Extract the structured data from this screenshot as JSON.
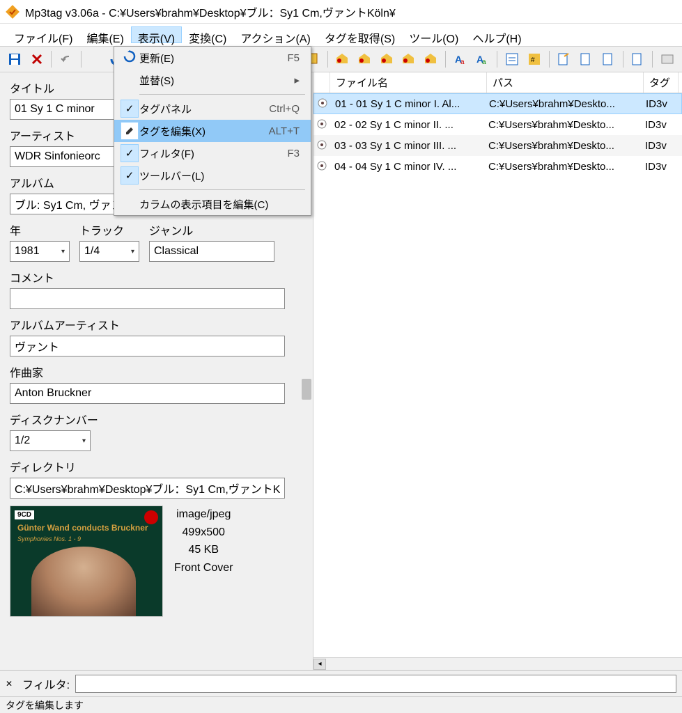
{
  "titlebar": {
    "text": "Mp3tag v3.06a  -  C:¥Users¥brahm¥Desktop¥ブル：Sy1 Cm,ヴァントKöln¥"
  },
  "menubar": {
    "items": [
      "ファイル(F)",
      "編集(E)",
      "表示(V)",
      "変換(C)",
      "アクション(A)",
      "タグを取得(S)",
      "ツール(O)",
      "ヘルプ(H)"
    ]
  },
  "dropdown": {
    "items": [
      {
        "label": "更新(E)",
        "shortcut": "F5",
        "icon": "refresh"
      },
      {
        "label": "並替(S)",
        "arrow": true
      },
      {
        "sep": true
      },
      {
        "label": "タグパネル",
        "shortcut": "Ctrl+Q",
        "checked": true
      },
      {
        "label": "タグを編集(X)",
        "shortcut": "ALT+T",
        "highlighted": true,
        "icon": "edit"
      },
      {
        "label": "フィルタ(F)",
        "shortcut": "F3",
        "checked": true
      },
      {
        "label": "ツールバー(L)",
        "checked": true
      },
      {
        "sep": true
      },
      {
        "label": "カラムの表示項目を編集(C)"
      }
    ]
  },
  "panel": {
    "title_label": "タイトル",
    "title_value": "01 Sy 1 C minor",
    "artist_label": "アーティスト",
    "artist_value": "WDR Sinfonieorc",
    "album_label": "アルバム",
    "album_value": "ブル: Sy1 Cm, ヴァント Köln",
    "year_label": "年",
    "year_value": "1981",
    "track_label": "トラック",
    "track_value": "1/4",
    "genre_label": "ジャンル",
    "genre_value": "Classical",
    "comment_label": "コメント",
    "comment_value": "",
    "albumartist_label": "アルバムアーティスト",
    "albumartist_value": "ヴァント",
    "composer_label": "作曲家",
    "composer_value": "Anton Bruckner",
    "disc_label": "ディスクナンバー",
    "disc_value": "1/2",
    "directory_label": "ディレクトリ",
    "directory_value": "C:¥Users¥brahm¥Desktop¥ブル：Sy1 Cm,ヴァントK",
    "cover_badge": "9CD",
    "cover_title": "Günter Wand conducts Bruckner",
    "cover_sub": "Symphonies Nos. 1 - 9",
    "cover_mime": "image/jpeg",
    "cover_dim": "499x500",
    "cover_size": "45 KB",
    "cover_type": "Front Cover"
  },
  "files": {
    "headers": [
      "ファイル名",
      "パス",
      "タグ"
    ],
    "rows": [
      {
        "name": "01 - 01 Sy 1 C minor I. Al...",
        "path": "C:¥Users¥brahm¥Deskto...",
        "tag": "ID3v",
        "selected": true
      },
      {
        "name": "02 - 02 Sy 1 C minor II. ...",
        "path": "C:¥Users¥brahm¥Deskto...",
        "tag": "ID3v"
      },
      {
        "name": "03 - 03 Sy 1 C minor III. ...",
        "path": "C:¥Users¥brahm¥Deskto...",
        "tag": "ID3v",
        "alt": true
      },
      {
        "name": "04 - 04 Sy 1 C minor IV. ...",
        "path": "C:¥Users¥brahm¥Deskto...",
        "tag": "ID3v"
      }
    ]
  },
  "filter": {
    "label": "フィルタ:",
    "value": ""
  },
  "status": {
    "text": "タグを編集します"
  }
}
